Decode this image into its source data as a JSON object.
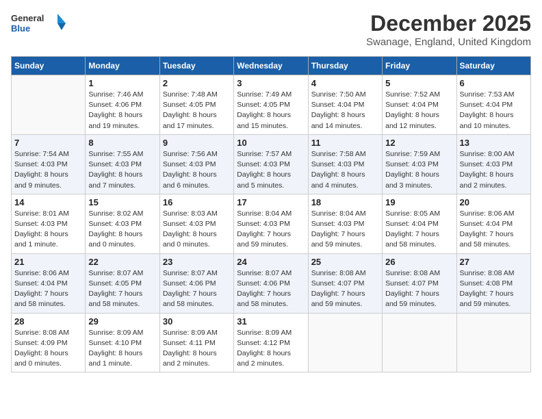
{
  "logo": {
    "text_general": "General",
    "text_blue": "Blue"
  },
  "title": "December 2025",
  "location": "Swanage, England, United Kingdom",
  "days_of_week": [
    "Sunday",
    "Monday",
    "Tuesday",
    "Wednesday",
    "Thursday",
    "Friday",
    "Saturday"
  ],
  "weeks": [
    [
      {
        "day": "",
        "info": ""
      },
      {
        "day": "1",
        "info": "Sunrise: 7:46 AM\nSunset: 4:06 PM\nDaylight: 8 hours\nand 19 minutes."
      },
      {
        "day": "2",
        "info": "Sunrise: 7:48 AM\nSunset: 4:05 PM\nDaylight: 8 hours\nand 17 minutes."
      },
      {
        "day": "3",
        "info": "Sunrise: 7:49 AM\nSunset: 4:05 PM\nDaylight: 8 hours\nand 15 minutes."
      },
      {
        "day": "4",
        "info": "Sunrise: 7:50 AM\nSunset: 4:04 PM\nDaylight: 8 hours\nand 14 minutes."
      },
      {
        "day": "5",
        "info": "Sunrise: 7:52 AM\nSunset: 4:04 PM\nDaylight: 8 hours\nand 12 minutes."
      },
      {
        "day": "6",
        "info": "Sunrise: 7:53 AM\nSunset: 4:04 PM\nDaylight: 8 hours\nand 10 minutes."
      }
    ],
    [
      {
        "day": "7",
        "info": "Sunrise: 7:54 AM\nSunset: 4:03 PM\nDaylight: 8 hours\nand 9 minutes."
      },
      {
        "day": "8",
        "info": "Sunrise: 7:55 AM\nSunset: 4:03 PM\nDaylight: 8 hours\nand 7 minutes."
      },
      {
        "day": "9",
        "info": "Sunrise: 7:56 AM\nSunset: 4:03 PM\nDaylight: 8 hours\nand 6 minutes."
      },
      {
        "day": "10",
        "info": "Sunrise: 7:57 AM\nSunset: 4:03 PM\nDaylight: 8 hours\nand 5 minutes."
      },
      {
        "day": "11",
        "info": "Sunrise: 7:58 AM\nSunset: 4:03 PM\nDaylight: 8 hours\nand 4 minutes."
      },
      {
        "day": "12",
        "info": "Sunrise: 7:59 AM\nSunset: 4:03 PM\nDaylight: 8 hours\nand 3 minutes."
      },
      {
        "day": "13",
        "info": "Sunrise: 8:00 AM\nSunset: 4:03 PM\nDaylight: 8 hours\nand 2 minutes."
      }
    ],
    [
      {
        "day": "14",
        "info": "Sunrise: 8:01 AM\nSunset: 4:03 PM\nDaylight: 8 hours\nand 1 minute."
      },
      {
        "day": "15",
        "info": "Sunrise: 8:02 AM\nSunset: 4:03 PM\nDaylight: 8 hours\nand 0 minutes."
      },
      {
        "day": "16",
        "info": "Sunrise: 8:03 AM\nSunset: 4:03 PM\nDaylight: 8 hours\nand 0 minutes."
      },
      {
        "day": "17",
        "info": "Sunrise: 8:04 AM\nSunset: 4:03 PM\nDaylight: 7 hours\nand 59 minutes."
      },
      {
        "day": "18",
        "info": "Sunrise: 8:04 AM\nSunset: 4:03 PM\nDaylight: 7 hours\nand 59 minutes."
      },
      {
        "day": "19",
        "info": "Sunrise: 8:05 AM\nSunset: 4:04 PM\nDaylight: 7 hours\nand 58 minutes."
      },
      {
        "day": "20",
        "info": "Sunrise: 8:06 AM\nSunset: 4:04 PM\nDaylight: 7 hours\nand 58 minutes."
      }
    ],
    [
      {
        "day": "21",
        "info": "Sunrise: 8:06 AM\nSunset: 4:04 PM\nDaylight: 7 hours\nand 58 minutes."
      },
      {
        "day": "22",
        "info": "Sunrise: 8:07 AM\nSunset: 4:05 PM\nDaylight: 7 hours\nand 58 minutes."
      },
      {
        "day": "23",
        "info": "Sunrise: 8:07 AM\nSunset: 4:06 PM\nDaylight: 7 hours\nand 58 minutes."
      },
      {
        "day": "24",
        "info": "Sunrise: 8:07 AM\nSunset: 4:06 PM\nDaylight: 7 hours\nand 58 minutes."
      },
      {
        "day": "25",
        "info": "Sunrise: 8:08 AM\nSunset: 4:07 PM\nDaylight: 7 hours\nand 59 minutes."
      },
      {
        "day": "26",
        "info": "Sunrise: 8:08 AM\nSunset: 4:07 PM\nDaylight: 7 hours\nand 59 minutes."
      },
      {
        "day": "27",
        "info": "Sunrise: 8:08 AM\nSunset: 4:08 PM\nDaylight: 7 hours\nand 59 minutes."
      }
    ],
    [
      {
        "day": "28",
        "info": "Sunrise: 8:08 AM\nSunset: 4:09 PM\nDaylight: 8 hours\nand 0 minutes."
      },
      {
        "day": "29",
        "info": "Sunrise: 8:09 AM\nSunset: 4:10 PM\nDaylight: 8 hours\nand 1 minute."
      },
      {
        "day": "30",
        "info": "Sunrise: 8:09 AM\nSunset: 4:11 PM\nDaylight: 8 hours\nand 2 minutes."
      },
      {
        "day": "31",
        "info": "Sunrise: 8:09 AM\nSunset: 4:12 PM\nDaylight: 8 hours\nand 2 minutes."
      },
      {
        "day": "",
        "info": ""
      },
      {
        "day": "",
        "info": ""
      },
      {
        "day": "",
        "info": ""
      }
    ]
  ]
}
